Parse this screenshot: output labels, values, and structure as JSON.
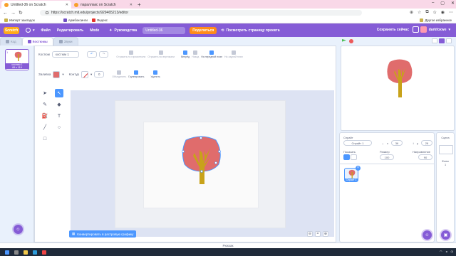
{
  "browser": {
    "tabs": [
      {
        "label": "Untitled-36 on Scratch",
        "active": true
      },
      {
        "label": "параллакс on Scratch",
        "active": false
      }
    ],
    "url": "https://scratch.mit.edu/projects/929465213/editor",
    "bookmarks": [
      "Импорт закладок",
      "Армбоксинги",
      "Яндекс"
    ],
    "bookmarks_right": "Другое избранное"
  },
  "menu": {
    "logo": "Scratch",
    "language_icon": "globe-icon",
    "file": "Файл",
    "edit": "Редактировать",
    "mode": "Мode",
    "tutorials": "Руководства",
    "project_title": "Untitled-36",
    "share": "Поделиться",
    "see_project": "Посмотреть страницу проекта",
    "save_now": "Сохранить сейчас",
    "username": "darkfoxwe"
  },
  "editor_tabs": [
    "Код",
    "Костюмы",
    "Звуки"
  ],
  "costumes": [
    {
      "number": "1",
      "name": "костюм 1",
      "size": "89 x 119"
    }
  ],
  "paint": {
    "costume_label": "Костюм",
    "costume_name": "костюм 1",
    "flip_h": "Отразить по горизонтали",
    "flip_v": "Отразить по вертикали",
    "forward": "Вперёд",
    "backward": "Назад",
    "front": "На передний план",
    "back": "На задний план",
    "fill_label": "Заливка",
    "outline_label": "Контур",
    "outline_width": "0",
    "ungroup": "Объединить",
    "group": "Группировать",
    "delete": "Удалить",
    "fill_color": "#e06c6c",
    "convert_bitmap": "Конвертировать в растровую графику",
    "zoom_level": "="
  },
  "sprite": {
    "sprite_label": "Спрайт",
    "sprite_name": "Спрайт 1",
    "x_label": "x",
    "x": "36",
    "y_label": "y",
    "y": "28",
    "show_label": "Показать",
    "size_label": "Размер",
    "size": "100",
    "direction_label": "Направление",
    "direction": "90",
    "tile_name": "Спрайт 1"
  },
  "stage_panel": {
    "title": "Сцена",
    "backdrops_label": "Фоны",
    "backdrops_count": "1"
  },
  "backpack": "Рюкзак"
}
